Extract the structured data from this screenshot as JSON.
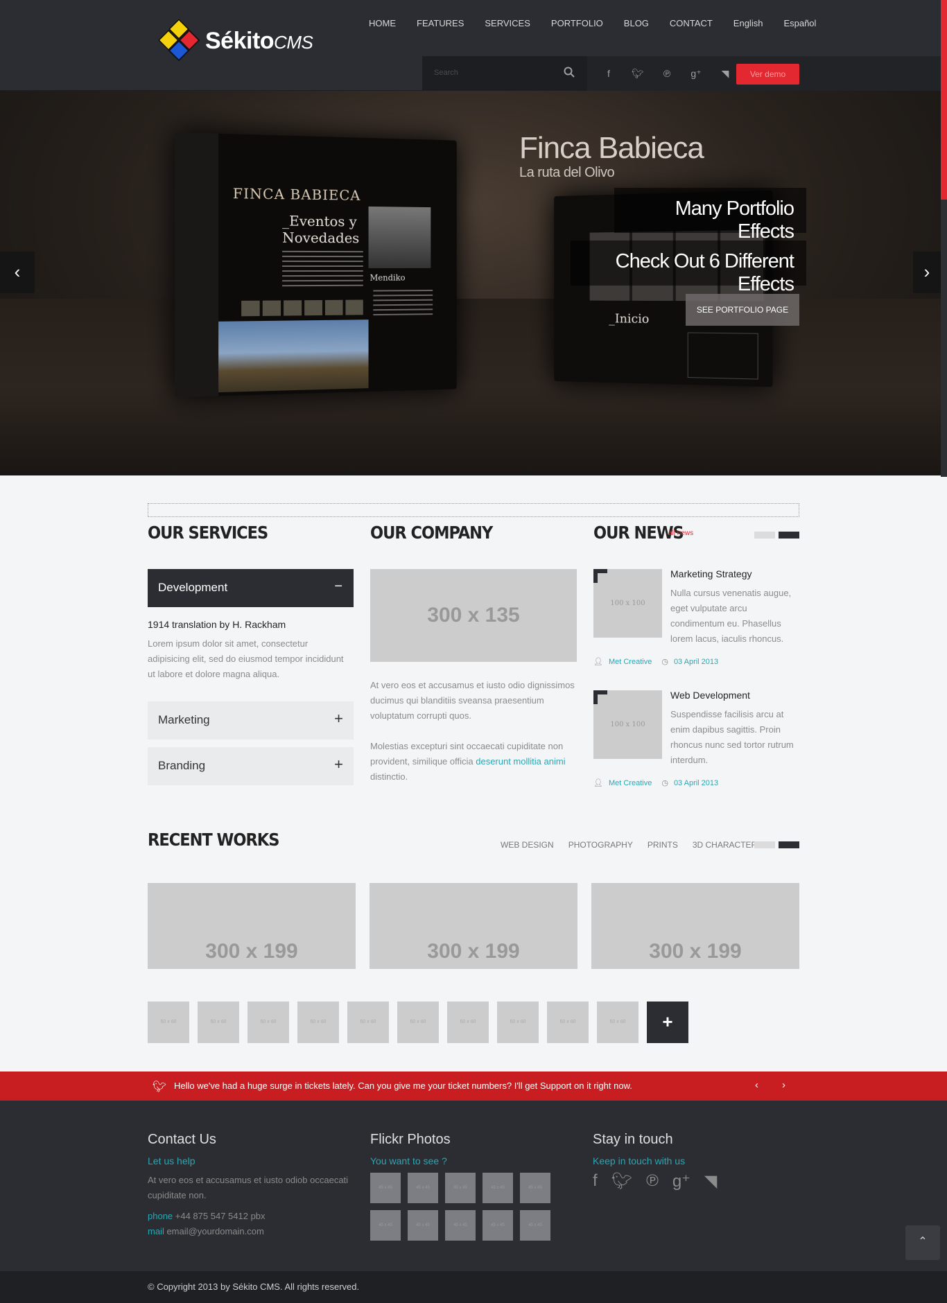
{
  "brand": {
    "name": "Sékito",
    "suffix": "CMS"
  },
  "nav": [
    "HOME",
    "FEATURES",
    "SERVICES",
    "PORTFOLIO",
    "BLOG",
    "CONTACT",
    "English",
    "Español"
  ],
  "search": {
    "placeholder": "Search"
  },
  "social_top": [
    "facebook-icon",
    "twitter-icon",
    "pinterest-icon",
    "google-plus-icon",
    "rss-icon"
  ],
  "demo_button": "Ver demo",
  "hero": {
    "title": "Finca Babieca",
    "subtitle": "La ruta del Olivo",
    "caption1": "Many Portfolio Effects",
    "caption2": "Check Out 6 Different Effects",
    "button": "SEE PORTFOLIO PAGE",
    "prev": "‹",
    "next": "›",
    "screen_left": {
      "brand": "FINCA BABIECA",
      "heading": "_Eventos y Novedades",
      "sub": "Mendiko"
    },
    "screen_right": {
      "heading": "_Inicio"
    }
  },
  "services": {
    "title": "OUR SERVICES",
    "open_item": {
      "label": "Development",
      "sign": "−",
      "question": "1914 translation by H. Rackham",
      "body": "Lorem ipsum dolor sit amet, consectetur adipisicing elit, sed do eiusmod tempor incididunt ut labore et dolore magna aliqua."
    },
    "items": [
      {
        "label": "Marketing",
        "sign": "+"
      },
      {
        "label": "Branding",
        "sign": "+"
      }
    ]
  },
  "company": {
    "title": "OUR COMPANY",
    "image_label": "300 x 135",
    "para1": "At vero eos et accusamus et iusto odio dignissimos ducimus qui blanditiis sveansa praesentium voluptatum corrupti quos.",
    "para2_pre": "Molestias excepturi sint occaecati cupiditate non provident, similique officia ",
    "para2_link": "deserunt mollitia animi",
    "para2_post": " distinctio."
  },
  "news": {
    "title": "OUR NEWS",
    "all_link": "all news",
    "items": [
      {
        "thumb": "100 x 100",
        "title": "Marketing Strategy",
        "text": "Nulla cursus venenatis augue, eget vulputate arcu condimentum eu. Phasellus lorem lacus, iaculis rhoncus.",
        "author": "Met Creative",
        "date": "03 April 2013"
      },
      {
        "thumb": "100 x 100",
        "title": "Web Development",
        "text": "Suspendisse facilisis arcu at enim dapibus sagittis. Proin rhoncus nunc sed tortor rutrum interdum.",
        "author": "Met Creative",
        "date": "03 April 2013"
      }
    ]
  },
  "works": {
    "title": "RECENT WORKS",
    "filters": [
      "WEB DESIGN",
      "PHOTOGRAPHY",
      "PRINTS",
      "3D CHARACTERS"
    ],
    "big": [
      "300 x 199",
      "300 x 199",
      "300 x 199"
    ],
    "small": [
      "60 x 60",
      "60 x 60",
      "60 x 60",
      "60 x 60",
      "60 x 60",
      "60 x 60",
      "60 x 60",
      "60 x 60",
      "60 x 60",
      "60 x 60"
    ],
    "more": "+"
  },
  "tweet": {
    "text": "Hello we've had a huge surge in tickets lately. Can you give me your ticket numbers? I'll get Support on it right now.",
    "prev": "‹",
    "next": "›"
  },
  "footer": {
    "contact": {
      "title": "Contact Us",
      "sub": "Let us help",
      "text": "At vero eos et accusamus et iusto odiob occaecati cupiditate non.",
      "phone_label": "phone",
      "phone": " +44 875 547 5412 pbx",
      "mail_label": "mail",
      "mail": " email@yourdomain.com"
    },
    "flickr": {
      "title": "Flickr Photos",
      "sub": "You want to see ?",
      "photos": [
        "45 x 45",
        "45 x 45",
        "45 x 45",
        "45 x 45",
        "45 x 45",
        "45 x 45",
        "45 x 45",
        "45 x 45",
        "45 x 45",
        "45 x 45"
      ]
    },
    "stay": {
      "title": "Stay in touch",
      "sub": "Keep in touch with us",
      "icons": [
        "facebook-icon",
        "twitter-icon",
        "pinterest-icon",
        "google-plus-icon",
        "rss-icon"
      ]
    },
    "to_top": "⌃"
  },
  "copyright": "© Copyright 2013 by Sékito CMS. All rights reserved.",
  "colors": {
    "accent": "#e32831",
    "teal": "#2aa7b3",
    "dark": "#2b2d33"
  }
}
